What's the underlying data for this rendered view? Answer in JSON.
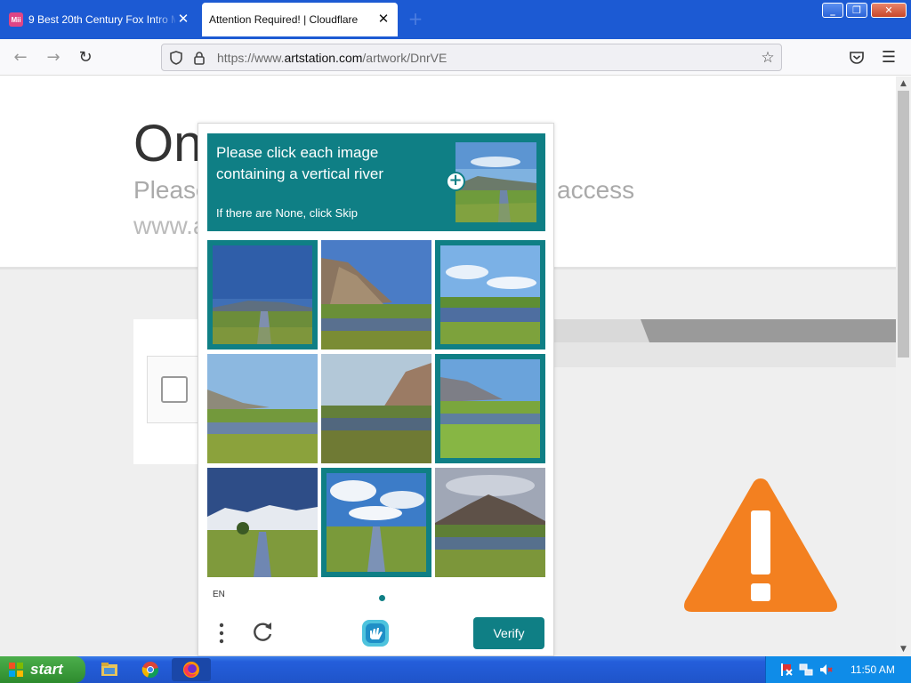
{
  "browser": {
    "tabs": [
      {
        "title": "9 Best 20th Century Fox Intro M",
        "favicon": "Mii",
        "active": false
      },
      {
        "title": "Attention Required! | Cloudflare",
        "active": true
      }
    ],
    "url": {
      "prefix": "https://www.",
      "domain": "artstation.com",
      "path": "/artwork/DnrVE"
    },
    "icons": [
      "back-icon",
      "forward-icon",
      "reload-icon",
      "shield-icon",
      "lock-icon",
      "bookmark-star-icon",
      "pocket-icon",
      "menu-icon"
    ]
  },
  "page": {
    "heading_partial": "On",
    "sub_left": "Please",
    "sub_right": "access",
    "domain_partial": "www.a"
  },
  "captcha": {
    "prompt": "Please click each image containing a vertical river",
    "skip_hint": "If there are None, click Skip",
    "language": "EN",
    "verify_label": "Verify",
    "accent": "#0f7f85",
    "tiles": [
      {
        "scene": "vertical river, blue sky, hill",
        "selected": true
      },
      {
        "scene": "rocky hill over lake",
        "selected": false
      },
      {
        "scene": "lake under cloudy sky",
        "selected": true
      },
      {
        "scene": "mountain, lake, grass",
        "selected": false
      },
      {
        "scene": "cliff over lake",
        "selected": false
      },
      {
        "scene": "mountain and grass field",
        "selected": true
      },
      {
        "scene": "snowy mountains, vertical stream",
        "selected": false
      },
      {
        "scene": "vertical river, cloudy sky",
        "selected": true
      },
      {
        "scene": "mountain and pond",
        "selected": false
      }
    ]
  },
  "taskbar": {
    "start_label": "start",
    "clock": "11:50 AM"
  }
}
